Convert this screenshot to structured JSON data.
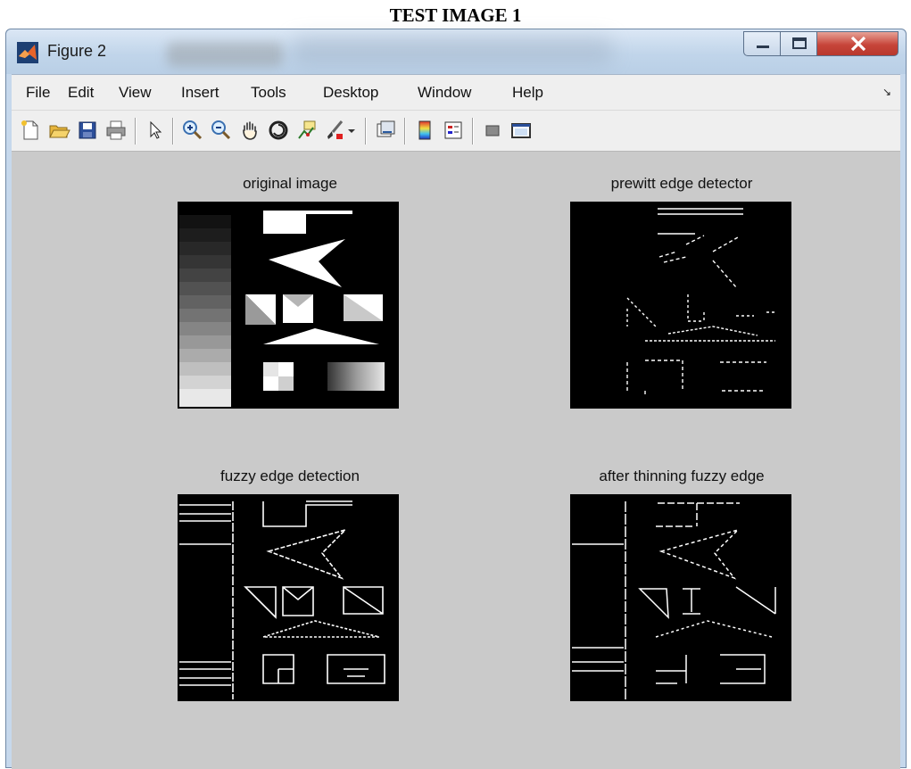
{
  "caption": "TEST IMAGE 1",
  "window": {
    "title": "Figure 2",
    "controls": {
      "minimize": "minimize",
      "maximize": "maximize",
      "close": "close"
    }
  },
  "menu": [
    "File",
    "Edit",
    "View",
    "Insert",
    "Tools",
    "Desktop",
    "Window",
    "Help"
  ],
  "toolbar": [
    "new-figure-icon",
    "open-file-icon",
    "save-icon",
    "print-icon",
    "edit-plot-arrow-icon",
    "zoom-in-icon",
    "zoom-out-icon",
    "pan-hand-icon",
    "rotate-3d-icon",
    "data-cursor-icon",
    "brush-icon",
    "brush-dropdown-icon",
    "link-plot-icon",
    "insert-colorbar-icon",
    "insert-legend-icon",
    "hide-plot-tools-icon",
    "show-plot-tools-icon"
  ],
  "plots": [
    {
      "title": "original image"
    },
    {
      "title": "prewitt edge detector"
    },
    {
      "title": "fuzzy edge detection"
    },
    {
      "title": "after thinning fuzzy edge"
    }
  ],
  "colors": {
    "canvas": "#cacaca",
    "close_button": "#c7453a",
    "menubar": "#efefef"
  }
}
